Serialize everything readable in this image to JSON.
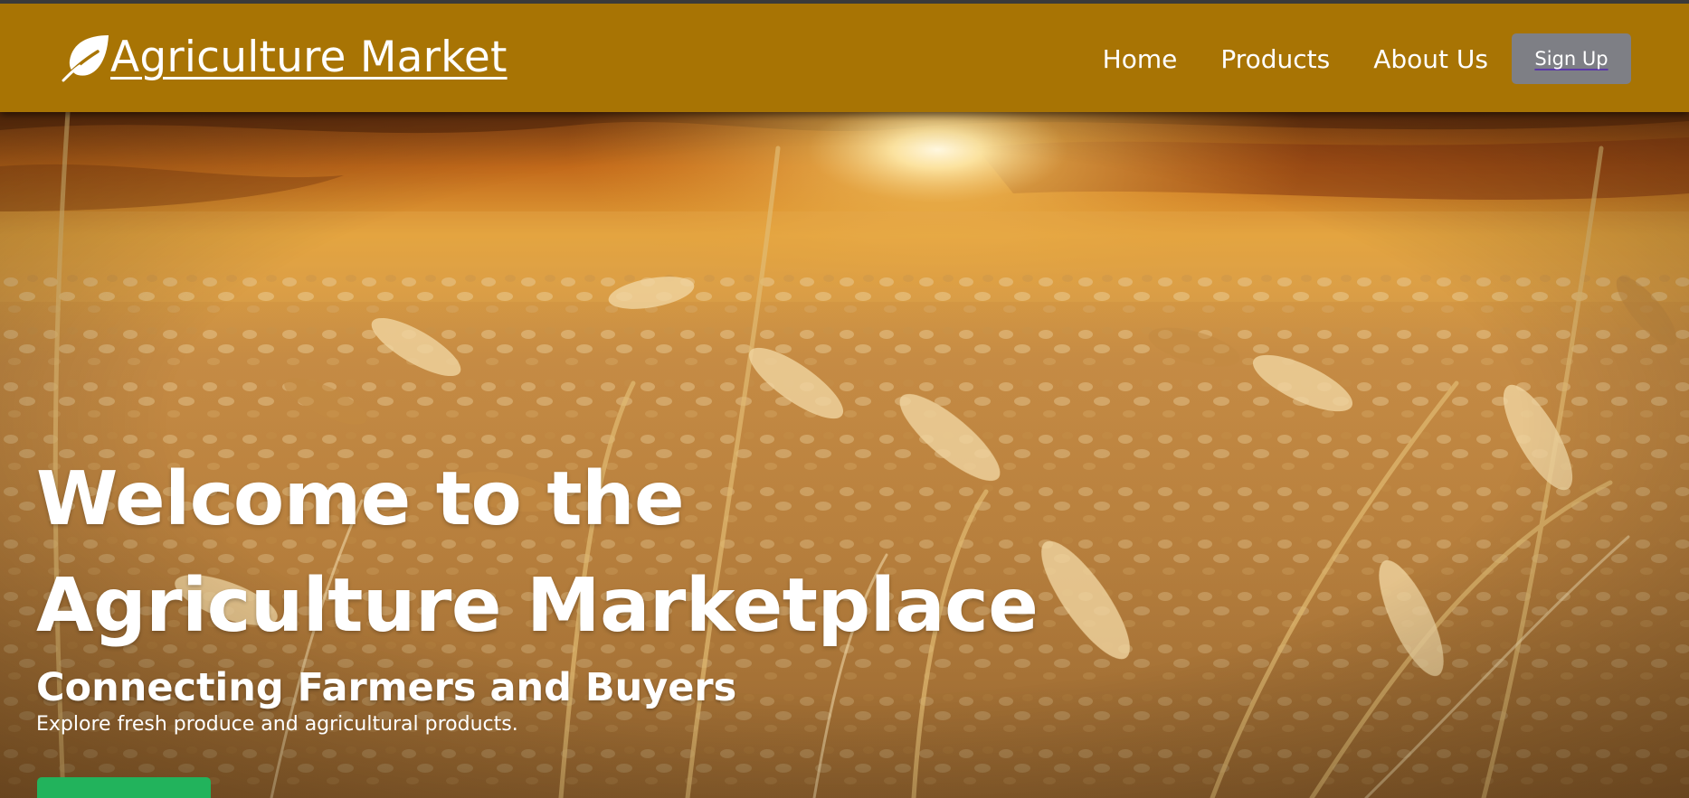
{
  "header": {
    "brand_name": "Agriculture Market",
    "brand_icon": "leaf-icon",
    "nav": [
      "Home",
      "Products",
      "About Us"
    ],
    "signup_label": "Sign Up"
  },
  "hero": {
    "title_line1": "Welcome to the",
    "title_line2": "Agriculture Marketplace",
    "subtitle": "Connecting Farmers and Buyers",
    "description": "Explore fresh produce and agricultural products.",
    "background": "wheat-field-sunset-image"
  },
  "colors": {
    "header_bg": "#a87404",
    "signup_bg": "#7e7f85",
    "cta_bg": "#22b35c"
  }
}
